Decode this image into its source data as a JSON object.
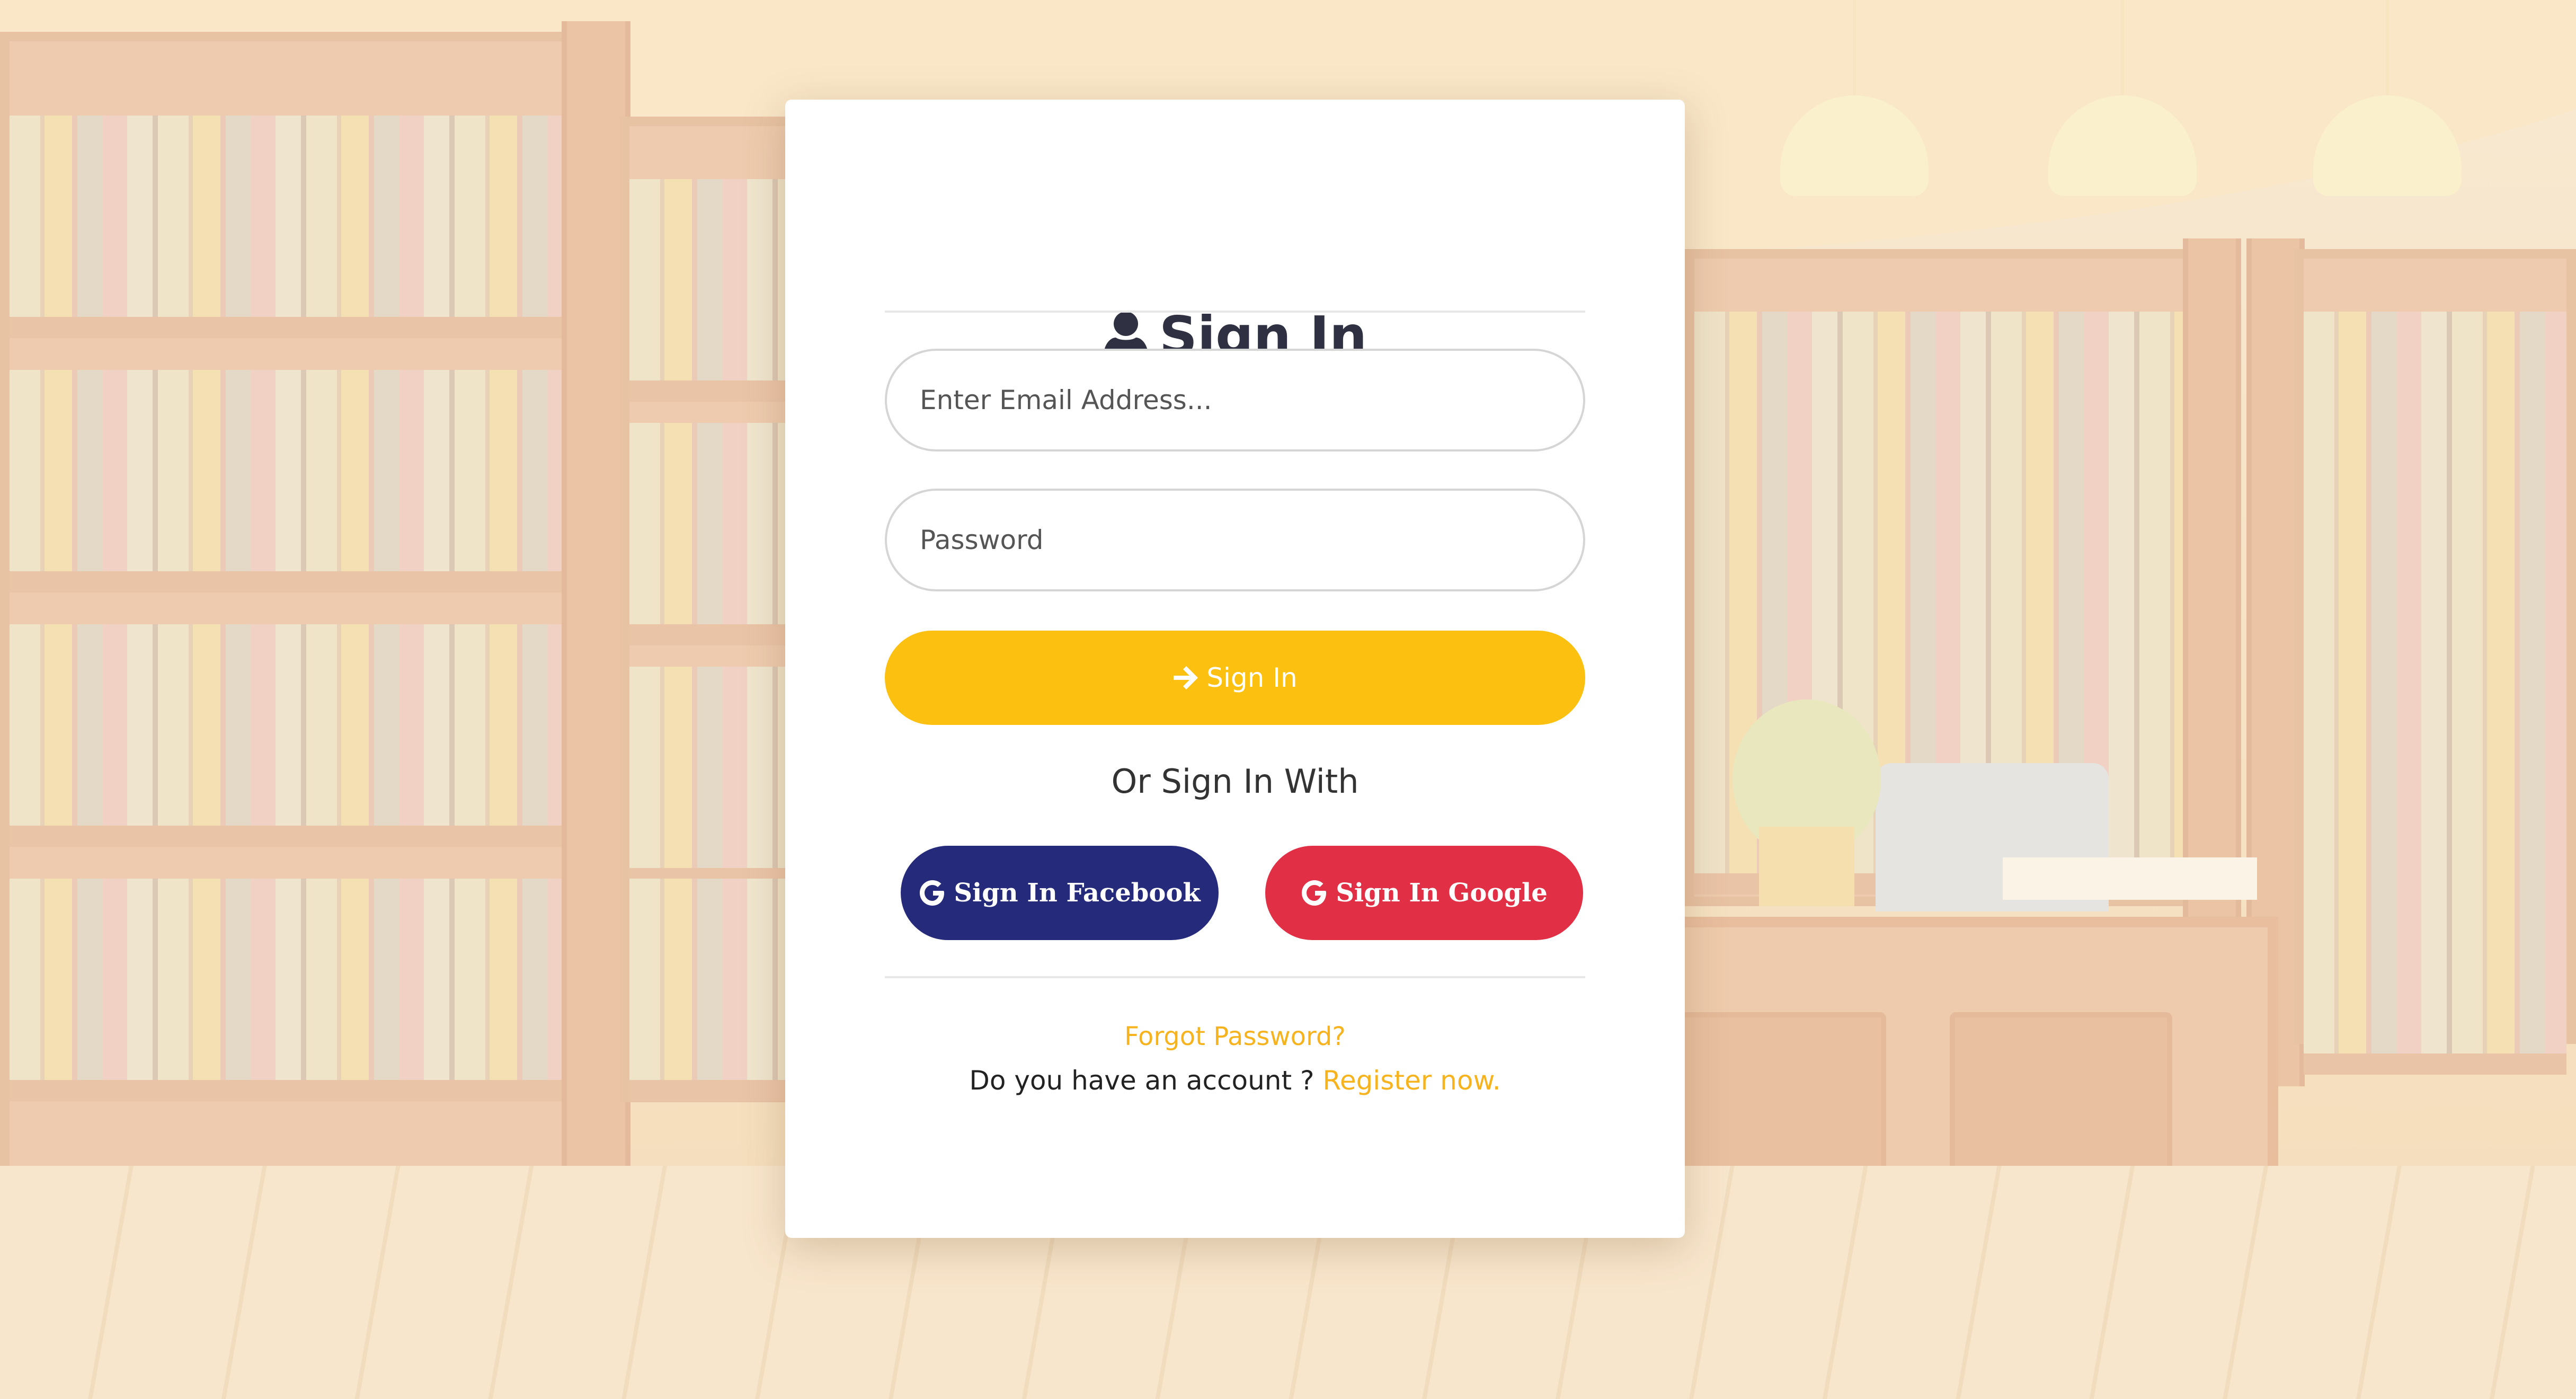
{
  "card": {
    "title": "Sign In",
    "email_placeholder": "Enter Email Address...",
    "password_placeholder": "Password",
    "sign_in_button": "Sign In",
    "or_text": "Or Sign In With",
    "facebook_button": "Sign In Facebook",
    "google_button": "Sign In Google",
    "forgot_password": "Forgot Password?",
    "account_prompt": "Do you have an account ?",
    "register_link": "Register now."
  },
  "colors": {
    "primary": "#fcc110",
    "facebook": "#262a7b",
    "google": "#e12f45",
    "link": "#f7b31e",
    "title": "#2f3143"
  },
  "icons": {
    "title_icon": "user-icon",
    "sign_in_icon": "arrow-right-icon",
    "facebook_icon": "google-g-icon",
    "google_icon": "google-g-icon"
  }
}
